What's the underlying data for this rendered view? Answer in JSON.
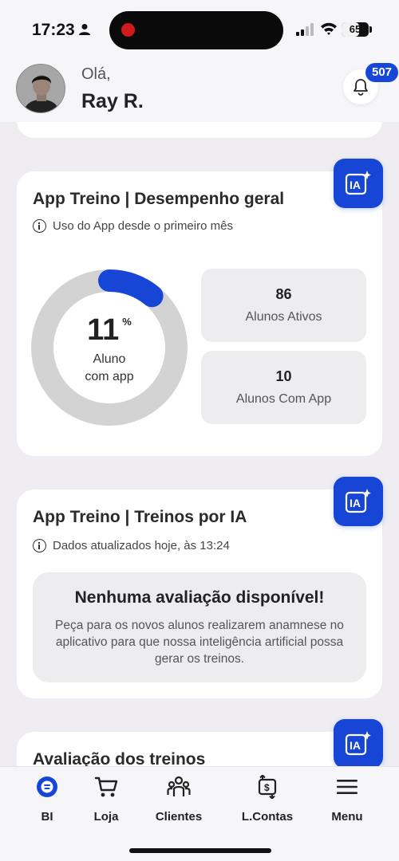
{
  "status_bar": {
    "time": "17:23",
    "battery": "65",
    "battery_level": 0.65,
    "icons": [
      "person-icon",
      "signal-icon",
      "wifi-icon",
      "battery-icon"
    ]
  },
  "header": {
    "greeting": "Olá,",
    "user_name": "Ray R.",
    "notification_count": "507"
  },
  "cards": {
    "performance": {
      "title": "App Treino | Desempenho geral",
      "info": "Uso do App desde o primeiro mês",
      "ia_label": "IA",
      "donut": {
        "value": "11",
        "unit": "%",
        "fraction": 0.11,
        "label_line1": "Aluno",
        "label_line2": "com app"
      },
      "stats": [
        {
          "value": "86",
          "label": "Alunos Ativos"
        },
        {
          "value": "10",
          "label": "Alunos Com App"
        }
      ]
    },
    "ai_workouts": {
      "title": "App Treino | Treinos por IA",
      "info": "Dados atualizados hoje, às 13:24",
      "ia_label": "IA",
      "empty_title": "Nenhuma avaliação disponível!",
      "empty_text": "Peça para os novos alunos realizarem anamnese no aplicativo para que nossa inteligência artificial possa gerar os treinos."
    },
    "evaluation": {
      "title": "Avaliação dos treinos",
      "ia_label": "IA"
    }
  },
  "nav": [
    {
      "label": "BI",
      "icon": "bi-icon",
      "active": true
    },
    {
      "label": "Loja",
      "icon": "cart-icon"
    },
    {
      "label": "Clientes",
      "icon": "clients-icon"
    },
    {
      "label": "L.Contas",
      "icon": "accounts-icon"
    },
    {
      "label": "Menu",
      "icon": "menu-icon"
    }
  ],
  "colors": {
    "accent": "#1746d6",
    "background": "#efedf1",
    "donut_track": "#d3d3d3"
  }
}
